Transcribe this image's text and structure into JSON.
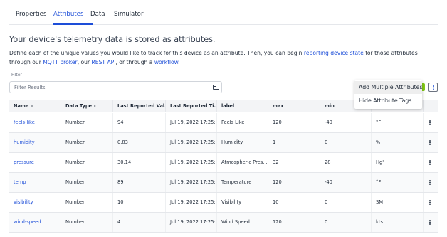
{
  "tabs": [
    {
      "label": "Properties"
    },
    {
      "label": "Attributes"
    },
    {
      "label": "Data"
    },
    {
      "label": "Simulator"
    }
  ],
  "headline": "Your device's telemetry data is stored as attributes.",
  "description": {
    "part1": "Define each of the unique values you would like to track for this device as an attribute. Then, you can begin ",
    "link1": "reporting device state",
    "part2": " for those attributes through our ",
    "link2": "MQTT broker",
    "part3": ", our ",
    "link3": "REST API",
    "part4": ", or through a ",
    "link4": "workflow",
    "part5": "."
  },
  "filter": {
    "label": "Filter",
    "placeholder": "Filter Results"
  },
  "menu": {
    "items": [
      "Add Multiple Attributes",
      "Hide Attribute Tags"
    ]
  },
  "colors": {
    "link": "#1d4ed8",
    "accent": "#84cc16"
  },
  "table": {
    "columns": [
      "Name",
      "Data Type",
      "Last Reported Val...",
      "Last Reported Ti...",
      "label",
      "max",
      "min",
      "",
      ""
    ],
    "rows": [
      {
        "name": "feels-like",
        "type": "Number",
        "value": "94",
        "time": "Jul 19, 2022 17:25:1...",
        "label": "Feels Like",
        "max": "120",
        "min": "-40",
        "unit": "°F"
      },
      {
        "name": "humidity",
        "type": "Number",
        "value": "0.83",
        "time": "Jul 19, 2022 17:25:1...",
        "label": "Humidity",
        "max": "1",
        "min": "0",
        "unit": "%"
      },
      {
        "name": "pressure",
        "type": "Number",
        "value": "30.14",
        "time": "Jul 19, 2022 17:25:1...",
        "label": "Atmospheric Pres...",
        "max": "32",
        "min": "28",
        "unit": "Hg\""
      },
      {
        "name": "temp",
        "type": "Number",
        "value": "89",
        "time": "Jul 19, 2022 17:25:1...",
        "label": "Temperature",
        "max": "120",
        "min": "-40",
        "unit": "°F"
      },
      {
        "name": "visibility",
        "type": "Number",
        "value": "10",
        "time": "Jul 19, 2022 17:25:1...",
        "label": "Visibility",
        "max": "10",
        "min": "0",
        "unit": "SM"
      },
      {
        "name": "wind-speed",
        "type": "Number",
        "value": "4",
        "time": "Jul 19, 2022 17:25:1...",
        "label": "Wind Speed",
        "max": "120",
        "min": "0",
        "unit": "kts"
      }
    ]
  }
}
